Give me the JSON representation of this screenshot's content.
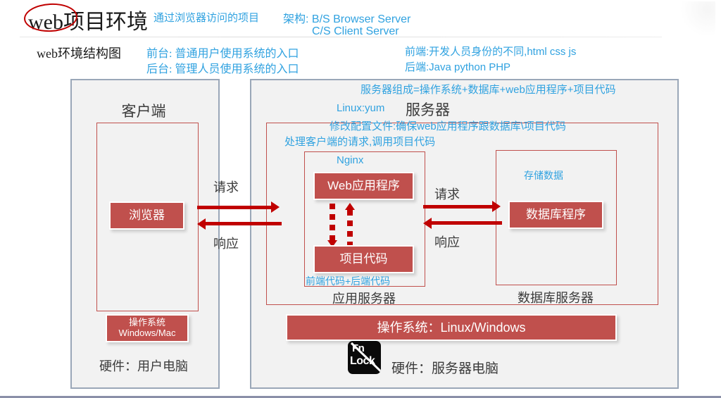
{
  "header": {
    "title": "web项目环境",
    "title_highlight": "web",
    "note_browser": "通过浏览器访问的项目",
    "arch_line1": "架构: B/S  Browser  Server",
    "arch_line2": "C/S  Client  Server",
    "subtitle": "web环境结构图",
    "front_desk": "前台: 普通用户使用系统的入口",
    "back_desk": "后台: 管理人员使用系统的入口",
    "frontend": "前端:开发人员身份的不同,html  css  js",
    "backend": "后端:Java python PHP"
  },
  "client": {
    "panel_title": "客户端",
    "browser_box": "浏览器",
    "os_line1": "操作系统",
    "os_line2": "Windows/Mac",
    "hardware": "硬件：用户电脑"
  },
  "server": {
    "panel_title": "服务器",
    "composition_note": "服务器组成=操作系统+数据库+web应用程序+项目代码",
    "linux_yum": "Linux:yum",
    "config_note": "修改配置文件:确保web应用程序跟数据库\\项目代码",
    "handle_note": "处理客户端的请求,调用项目代码",
    "os_bar": "操作系统：Linux/Windows",
    "hardware": "硬件：服务器电脑"
  },
  "app_server": {
    "nginx_label": "Nginx",
    "web_app": "Web应用程序",
    "project_code": "项目代码",
    "code_note": "前端代码+后端代码",
    "caption": "应用服务器"
  },
  "db_server": {
    "store_note": "存储数据",
    "db_program": "数据库程序",
    "caption": "数据库服务器"
  },
  "arrows": {
    "request": "请求",
    "response": "响应",
    "request2": "请求",
    "response2": "响应"
  },
  "osd": {
    "fn_label": "Fn",
    "lock_label": "Lock"
  },
  "colors": {
    "accent_red": "#c0504d",
    "arrow_red": "#c00000",
    "note_blue": "#30a2e0",
    "panel_bg": "#f2f2f2",
    "panel_border": "#9aa7b8"
  }
}
